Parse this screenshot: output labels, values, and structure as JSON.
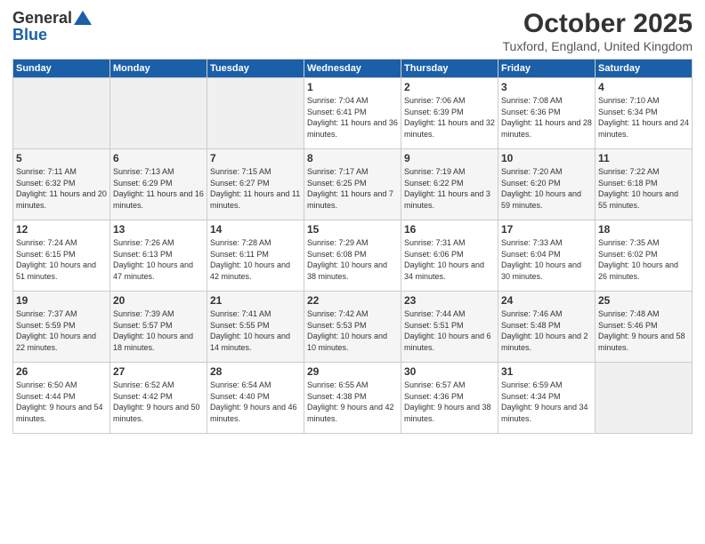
{
  "logo": {
    "general": "General",
    "blue": "Blue"
  },
  "title": "October 2025",
  "location": "Tuxford, England, United Kingdom",
  "days_of_week": [
    "Sunday",
    "Monday",
    "Tuesday",
    "Wednesday",
    "Thursday",
    "Friday",
    "Saturday"
  ],
  "weeks": [
    [
      {
        "day": "",
        "empty": true
      },
      {
        "day": "",
        "empty": true
      },
      {
        "day": "",
        "empty": true
      },
      {
        "day": "1",
        "sunrise": "Sunrise: 7:04 AM",
        "sunset": "Sunset: 6:41 PM",
        "daylight": "Daylight: 11 hours and 36 minutes."
      },
      {
        "day": "2",
        "sunrise": "Sunrise: 7:06 AM",
        "sunset": "Sunset: 6:39 PM",
        "daylight": "Daylight: 11 hours and 32 minutes."
      },
      {
        "day": "3",
        "sunrise": "Sunrise: 7:08 AM",
        "sunset": "Sunset: 6:36 PM",
        "daylight": "Daylight: 11 hours and 28 minutes."
      },
      {
        "day": "4",
        "sunrise": "Sunrise: 7:10 AM",
        "sunset": "Sunset: 6:34 PM",
        "daylight": "Daylight: 11 hours and 24 minutes."
      }
    ],
    [
      {
        "day": "5",
        "sunrise": "Sunrise: 7:11 AM",
        "sunset": "Sunset: 6:32 PM",
        "daylight": "Daylight: 11 hours and 20 minutes."
      },
      {
        "day": "6",
        "sunrise": "Sunrise: 7:13 AM",
        "sunset": "Sunset: 6:29 PM",
        "daylight": "Daylight: 11 hours and 16 minutes."
      },
      {
        "day": "7",
        "sunrise": "Sunrise: 7:15 AM",
        "sunset": "Sunset: 6:27 PM",
        "daylight": "Daylight: 11 hours and 11 minutes."
      },
      {
        "day": "8",
        "sunrise": "Sunrise: 7:17 AM",
        "sunset": "Sunset: 6:25 PM",
        "daylight": "Daylight: 11 hours and 7 minutes."
      },
      {
        "day": "9",
        "sunrise": "Sunrise: 7:19 AM",
        "sunset": "Sunset: 6:22 PM",
        "daylight": "Daylight: 11 hours and 3 minutes."
      },
      {
        "day": "10",
        "sunrise": "Sunrise: 7:20 AM",
        "sunset": "Sunset: 6:20 PM",
        "daylight": "Daylight: 10 hours and 59 minutes."
      },
      {
        "day": "11",
        "sunrise": "Sunrise: 7:22 AM",
        "sunset": "Sunset: 6:18 PM",
        "daylight": "Daylight: 10 hours and 55 minutes."
      }
    ],
    [
      {
        "day": "12",
        "sunrise": "Sunrise: 7:24 AM",
        "sunset": "Sunset: 6:15 PM",
        "daylight": "Daylight: 10 hours and 51 minutes."
      },
      {
        "day": "13",
        "sunrise": "Sunrise: 7:26 AM",
        "sunset": "Sunset: 6:13 PM",
        "daylight": "Daylight: 10 hours and 47 minutes."
      },
      {
        "day": "14",
        "sunrise": "Sunrise: 7:28 AM",
        "sunset": "Sunset: 6:11 PM",
        "daylight": "Daylight: 10 hours and 42 minutes."
      },
      {
        "day": "15",
        "sunrise": "Sunrise: 7:29 AM",
        "sunset": "Sunset: 6:08 PM",
        "daylight": "Daylight: 10 hours and 38 minutes."
      },
      {
        "day": "16",
        "sunrise": "Sunrise: 7:31 AM",
        "sunset": "Sunset: 6:06 PM",
        "daylight": "Daylight: 10 hours and 34 minutes."
      },
      {
        "day": "17",
        "sunrise": "Sunrise: 7:33 AM",
        "sunset": "Sunset: 6:04 PM",
        "daylight": "Daylight: 10 hours and 30 minutes."
      },
      {
        "day": "18",
        "sunrise": "Sunrise: 7:35 AM",
        "sunset": "Sunset: 6:02 PM",
        "daylight": "Daylight: 10 hours and 26 minutes."
      }
    ],
    [
      {
        "day": "19",
        "sunrise": "Sunrise: 7:37 AM",
        "sunset": "Sunset: 5:59 PM",
        "daylight": "Daylight: 10 hours and 22 minutes."
      },
      {
        "day": "20",
        "sunrise": "Sunrise: 7:39 AM",
        "sunset": "Sunset: 5:57 PM",
        "daylight": "Daylight: 10 hours and 18 minutes."
      },
      {
        "day": "21",
        "sunrise": "Sunrise: 7:41 AM",
        "sunset": "Sunset: 5:55 PM",
        "daylight": "Daylight: 10 hours and 14 minutes."
      },
      {
        "day": "22",
        "sunrise": "Sunrise: 7:42 AM",
        "sunset": "Sunset: 5:53 PM",
        "daylight": "Daylight: 10 hours and 10 minutes."
      },
      {
        "day": "23",
        "sunrise": "Sunrise: 7:44 AM",
        "sunset": "Sunset: 5:51 PM",
        "daylight": "Daylight: 10 hours and 6 minutes."
      },
      {
        "day": "24",
        "sunrise": "Sunrise: 7:46 AM",
        "sunset": "Sunset: 5:48 PM",
        "daylight": "Daylight: 10 hours and 2 minutes."
      },
      {
        "day": "25",
        "sunrise": "Sunrise: 7:48 AM",
        "sunset": "Sunset: 5:46 PM",
        "daylight": "Daylight: 9 hours and 58 minutes."
      }
    ],
    [
      {
        "day": "26",
        "sunrise": "Sunrise: 6:50 AM",
        "sunset": "Sunset: 4:44 PM",
        "daylight": "Daylight: 9 hours and 54 minutes."
      },
      {
        "day": "27",
        "sunrise": "Sunrise: 6:52 AM",
        "sunset": "Sunset: 4:42 PM",
        "daylight": "Daylight: 9 hours and 50 minutes."
      },
      {
        "day": "28",
        "sunrise": "Sunrise: 6:54 AM",
        "sunset": "Sunset: 4:40 PM",
        "daylight": "Daylight: 9 hours and 46 minutes."
      },
      {
        "day": "29",
        "sunrise": "Sunrise: 6:55 AM",
        "sunset": "Sunset: 4:38 PM",
        "daylight": "Daylight: 9 hours and 42 minutes."
      },
      {
        "day": "30",
        "sunrise": "Sunrise: 6:57 AM",
        "sunset": "Sunset: 4:36 PM",
        "daylight": "Daylight: 9 hours and 38 minutes."
      },
      {
        "day": "31",
        "sunrise": "Sunrise: 6:59 AM",
        "sunset": "Sunset: 4:34 PM",
        "daylight": "Daylight: 9 hours and 34 minutes."
      },
      {
        "day": "",
        "empty": true
      }
    ]
  ]
}
